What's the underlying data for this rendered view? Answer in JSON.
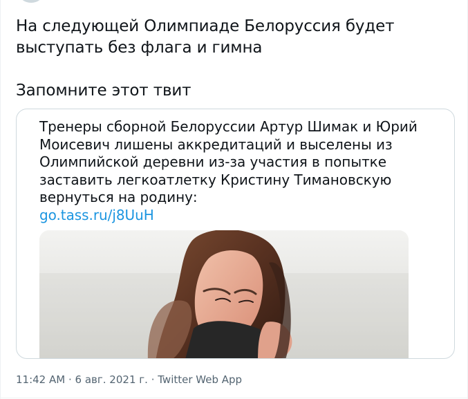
{
  "tweet": {
    "text_lines": [
      "На следующей Олимпиаде Белоруссия будет",
      "выступать без флага и гимна",
      "Запомните этот твит"
    ]
  },
  "quote": {
    "text_lines": [
      "Тренеры сборной Белоруссии Артур Шимак и Юрий",
      "Моисевич лишены аккредитаций и выселены из",
      "Олимпийской деревни из-за участия в попытке",
      "заставить легкоатлетку Кристину Тимановскую",
      "вернуться на родину:"
    ],
    "link": "go.tass.ru/j8UuH"
  },
  "meta": {
    "time": "11:42 AM",
    "separator": "·",
    "date": "6 авг. 2021 г.",
    "source": "Twitter Web App"
  },
  "colors": {
    "text": "#0f1419",
    "link": "#1b95e0",
    "secondary": "#536471",
    "border": "#cfd9de"
  }
}
